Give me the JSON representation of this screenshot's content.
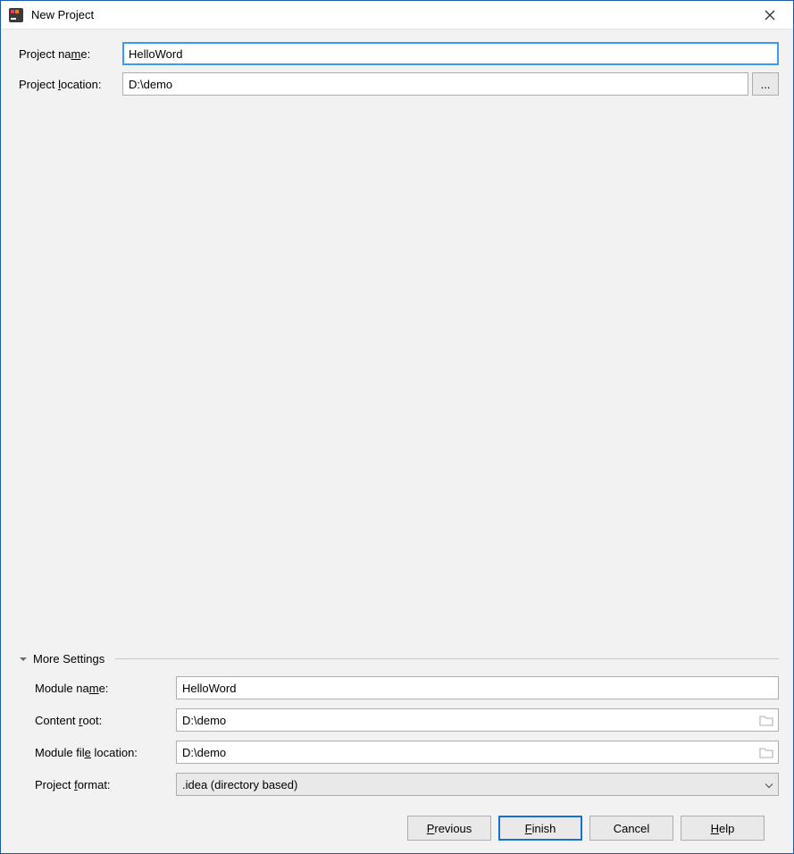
{
  "title": "New Project",
  "fields": {
    "project_name": {
      "label": "Project name:",
      "value": "HelloWord"
    },
    "project_location": {
      "label": "Project location:",
      "value": "D:\\demo",
      "browse": "..."
    }
  },
  "more_settings": {
    "header": "More Settings",
    "module_name": {
      "label": "Module name:",
      "value": "HelloWord"
    },
    "content_root": {
      "label": "Content root:",
      "value": "D:\\demo"
    },
    "module_file_location": {
      "label": "Module file location:",
      "value": "D:\\demo"
    },
    "project_format": {
      "label": "Project format:",
      "value": ".idea (directory based)"
    }
  },
  "buttons": {
    "previous": "Previous",
    "finish": "Finish",
    "cancel": "Cancel",
    "help": "Help"
  }
}
